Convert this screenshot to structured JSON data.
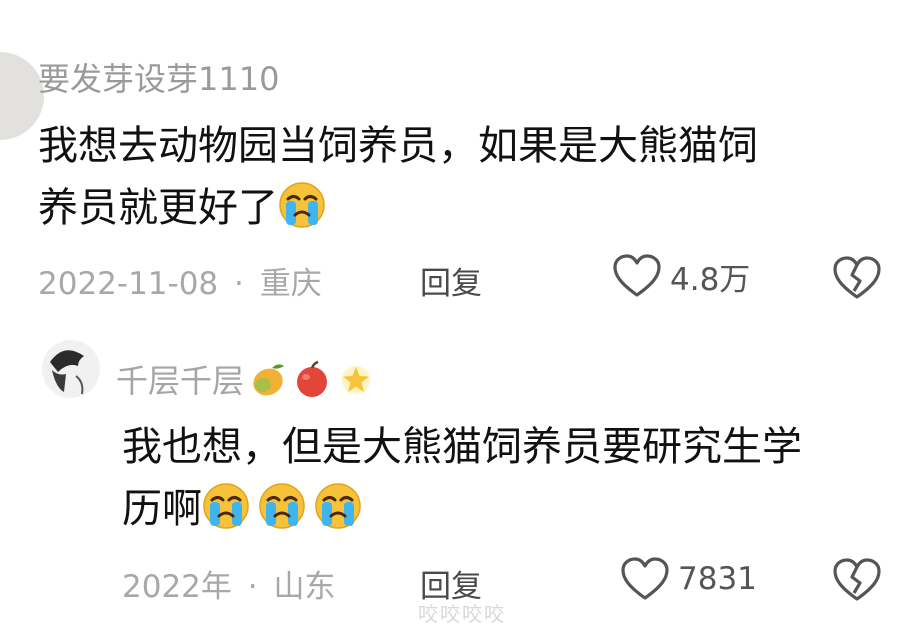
{
  "comment": {
    "username": "要发芽设芽1110",
    "text_line1": "我想去动物园当饲养员，如果是大熊猫饲",
    "text_line2": "养员就更好了",
    "date": "2022-11-08",
    "sep": "·",
    "location": "重庆",
    "reply_label": "回复",
    "likes": "4.8万"
  },
  "reply": {
    "username": "千层千层",
    "text_line1": "我也想，但是大熊猫饲养员要研究生学",
    "text_line2": "历啊",
    "date": "2022年",
    "sep": "·",
    "location": "山东",
    "reply_label": "回复",
    "likes": "7831"
  },
  "icons": {
    "like": "heart-outline-icon",
    "dislike": "broken-heart-icon",
    "crying": "crying-face-emoji",
    "mango": "mango-emoji",
    "apple": "red-apple-emoji",
    "star": "glowing-star-emoji"
  },
  "watermark": "咬咬咬咬"
}
